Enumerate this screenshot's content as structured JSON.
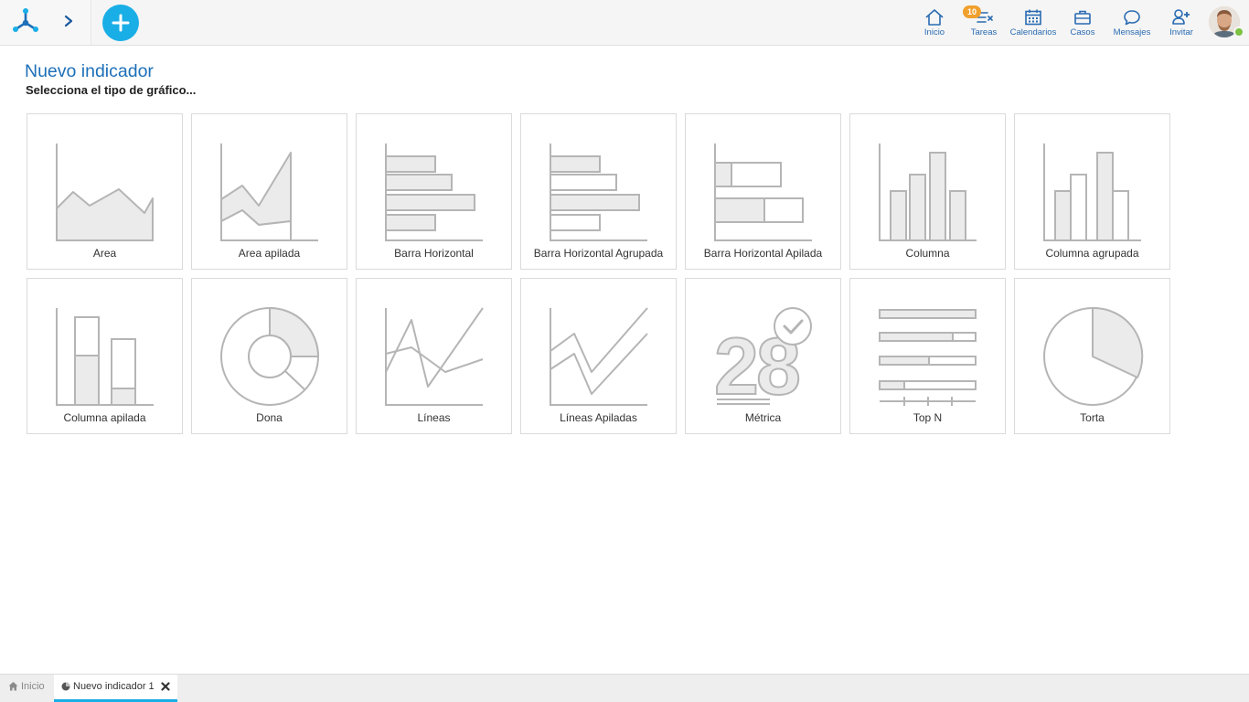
{
  "header": {
    "nav": [
      {
        "id": "inicio",
        "label": "Inicio",
        "icon": "home-icon"
      },
      {
        "id": "tareas",
        "label": "Tareas",
        "icon": "tasks-icon"
      },
      {
        "id": "calendarios",
        "label": "Calendarios",
        "icon": "calendar-icon"
      },
      {
        "id": "casos",
        "label": "Casos",
        "icon": "briefcase-icon"
      },
      {
        "id": "mensajes",
        "label": "Mensajes",
        "icon": "chat-icon"
      },
      {
        "id": "invitar",
        "label": "Invitar",
        "icon": "add-user-icon"
      }
    ],
    "tasks_badge": "10",
    "accent": "#1aaee6",
    "nav_text_color": "#2a6bb2",
    "badge_color": "#f0a02c",
    "online_color": "#7cc142"
  },
  "page": {
    "title": "Nuevo indicador",
    "subtitle": "Selecciona el tipo de gráfico..."
  },
  "chart_types": [
    {
      "label": "Area",
      "icon": "area-chart-icon"
    },
    {
      "label": "Area apilada",
      "icon": "stacked-area-chart-icon"
    },
    {
      "label": "Barra Horizontal",
      "icon": "horizontal-bar-chart-icon"
    },
    {
      "label": "Barra Horizontal Agrupada",
      "icon": "grouped-horizontal-bar-chart-icon"
    },
    {
      "label": "Barra Horizontal Apilada",
      "icon": "stacked-horizontal-bar-chart-icon"
    },
    {
      "label": "Columna",
      "icon": "column-chart-icon"
    },
    {
      "label": "Columna agrupada",
      "icon": "grouped-column-chart-icon"
    },
    {
      "label": "Columna apilada",
      "icon": "stacked-column-chart-icon"
    },
    {
      "label": "Dona",
      "icon": "donut-chart-icon"
    },
    {
      "label": "Líneas",
      "icon": "line-chart-icon"
    },
    {
      "label": "Líneas Apiladas",
      "icon": "stacked-line-chart-icon"
    },
    {
      "label": "Métrica",
      "icon": "metric-icon"
    },
    {
      "label": "Top N",
      "icon": "top-n-icon"
    },
    {
      "label": "Torta",
      "icon": "pie-chart-icon"
    }
  ],
  "tabs": {
    "home_label": "Inicio",
    "active_label": "Nuevo indicador 1"
  }
}
